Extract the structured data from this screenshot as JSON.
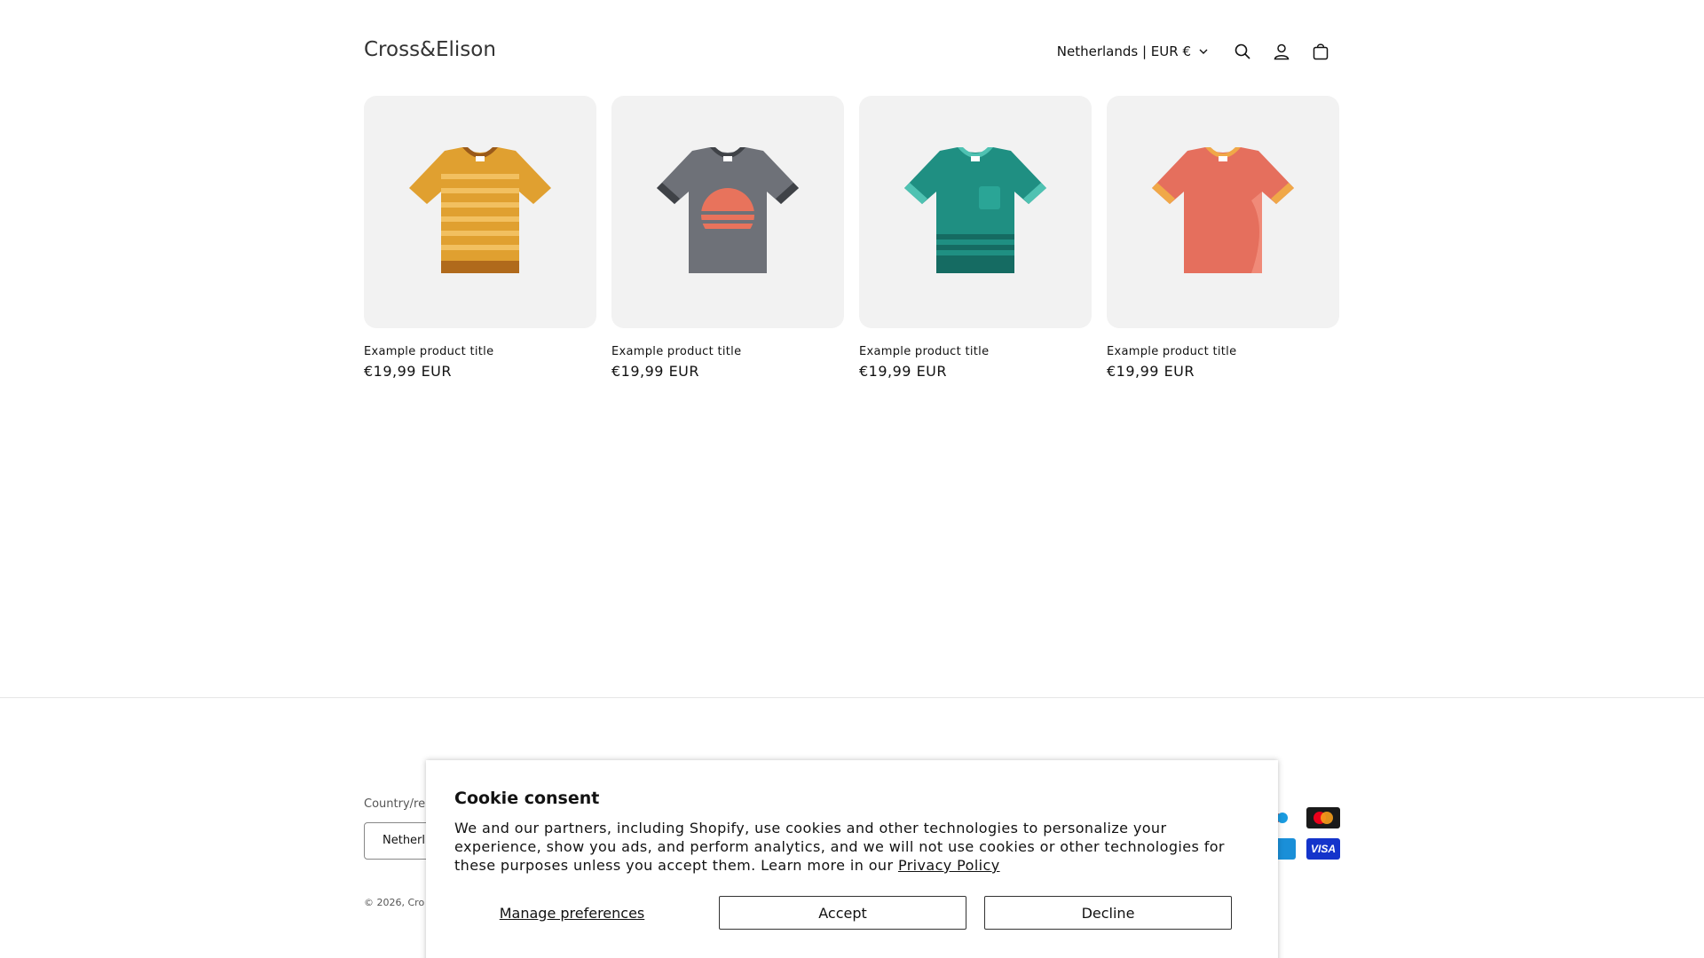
{
  "header": {
    "logo": "Cross&Elison",
    "locale": "Netherlands | EUR €",
    "icons": [
      "search-icon",
      "account-icon",
      "cart-icon"
    ]
  },
  "products": [
    {
      "title": "Example product title",
      "price": "€19,99 EUR",
      "shirt": "orange-striped"
    },
    {
      "title": "Example product title",
      "price": "€19,99 EUR",
      "shirt": "gray-sunset"
    },
    {
      "title": "Example product title",
      "price": "€19,99 EUR",
      "shirt": "teal-pocket"
    },
    {
      "title": "Example product title",
      "price": "€19,99 EUR",
      "shirt": "coral-plain"
    }
  ],
  "footer": {
    "country_label": "Country/re",
    "country_value": "Netherl",
    "copyright": "© 2026, Cro",
    "payment_icons": [
      "maestro-icon",
      "mastercard-icon",
      "unionpay-icon",
      "visa-icon"
    ],
    "visa_text": "VISA"
  },
  "cookie": {
    "title": "Cookie consent",
    "body": "We and our partners, including Shopify, use cookies and other technologies to personalize your experience, show you ads, and perform analytics, and we will not use cookies or other technologies for these purposes unless you accept them. Learn more in our ",
    "privacy_link": "Privacy Policy",
    "manage_label": "Manage preferences",
    "accept_label": "Accept",
    "decline_label": "Decline"
  }
}
